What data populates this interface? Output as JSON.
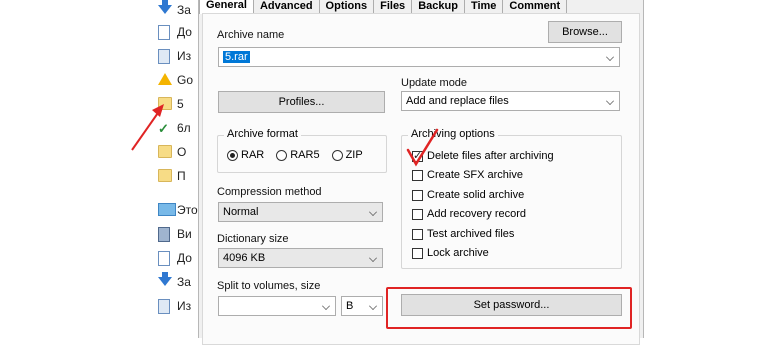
{
  "explorer": {
    "items": [
      {
        "icon": "download-icon",
        "label": "За"
      },
      {
        "icon": "document-icon",
        "label": "До"
      },
      {
        "icon": "image-icon",
        "label": "Из"
      },
      {
        "icon": "google-drive-icon",
        "label": "Go"
      },
      {
        "icon": "folder-icon",
        "label": "5"
      },
      {
        "icon": "check-folder-icon",
        "label": "6л"
      },
      {
        "icon": "folder-icon",
        "label": "О"
      },
      {
        "icon": "folder-icon",
        "label": "П"
      },
      {
        "icon": "computer-icon",
        "label": "Это"
      },
      {
        "icon": "video-icon",
        "label": "Ви"
      },
      {
        "icon": "document-icon",
        "label": "До"
      },
      {
        "icon": "download-icon",
        "label": "За"
      },
      {
        "icon": "image-icon",
        "label": "Из"
      }
    ]
  },
  "tabs": [
    {
      "label": "General",
      "active": true
    },
    {
      "label": "Advanced"
    },
    {
      "label": "Options"
    },
    {
      "label": "Files"
    },
    {
      "label": "Backup"
    },
    {
      "label": "Time"
    },
    {
      "label": "Comment"
    }
  ],
  "general": {
    "archive_name_label": "Archive name",
    "browse_label": "Browse...",
    "archive_name_value": "5.rar",
    "profiles_label": "Profiles...",
    "update_mode_label": "Update mode",
    "update_mode_value": "Add and replace files",
    "archive_format_label": "Archive format",
    "formats": [
      {
        "label": "RAR",
        "selected": true
      },
      {
        "label": "RAR5",
        "selected": false
      },
      {
        "label": "ZIP",
        "selected": false
      }
    ],
    "compression_label": "Compression method",
    "compression_value": "Normal",
    "dictionary_label": "Dictionary size",
    "dictionary_value": "4096 KB",
    "split_label": "Split to volumes, size",
    "split_value": "",
    "split_unit": "B",
    "archiving_options_label": "Archiving options",
    "options": [
      {
        "label": "Delete files after archiving",
        "checked": true
      },
      {
        "label": "Create SFX archive",
        "checked": false
      },
      {
        "label": "Create solid archive",
        "checked": false
      },
      {
        "label": "Add recovery record",
        "checked": false
      },
      {
        "label": "Test archived files",
        "checked": false
      },
      {
        "label": "Lock archive",
        "checked": false
      }
    ],
    "set_password_label": "Set password..."
  },
  "colors": {
    "annotation": "#e02424",
    "selection": "#0078d7"
  }
}
